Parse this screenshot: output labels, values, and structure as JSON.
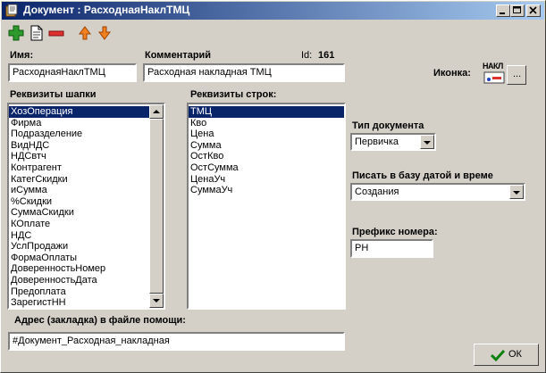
{
  "window": {
    "title": "Документ : РасходнаяНаклТМЦ"
  },
  "toolbar": {
    "icons": [
      "add-icon",
      "document-icon",
      "delete-icon",
      "move-up-icon",
      "move-down-icon"
    ]
  },
  "form": {
    "name_label": "Имя:",
    "name_value": "РасходнаяНаклТМЦ",
    "comment_label": "Комментарий",
    "id_label": "Id:",
    "id_value": "161",
    "comment_value": "Расходная накладная ТМЦ",
    "icon_label": "Иконка:",
    "icon_caption": "НАКЛ",
    "icon_button_label": "...",
    "header_props_label": "Реквизиты шапки",
    "header_props": [
      "ХозОперация",
      "Фирма",
      "Подразделение",
      "ВидНДС",
      "НДСвтч",
      "Контрагент",
      "КатегСкидки",
      "иСумма",
      "%Скидки",
      "СуммаСкидки",
      "КОплате",
      "НДС",
      "УслПродажи",
      "ФормаОплаты",
      "ДоверенностьНомер",
      "ДоверенностьДата",
      "Предоплата",
      "ЗарегистНН"
    ],
    "row_props_label": "Реквизиты строк:",
    "row_props": [
      "ТМЦ",
      "Кво",
      "Цена",
      "Сумма",
      "ОстКво",
      "ОстСумма",
      "ЦенаУч",
      "СуммаУч"
    ],
    "doc_type_label": "Тип документа",
    "doc_type_value": "Первичка",
    "write_label": "Писать в базу датой и време",
    "write_value": "Создания",
    "prefix_label": "Префикс номера:",
    "prefix_value": "РН",
    "help_label": "Адрес (закладка) в файле помощи:",
    "help_value": "#Документ_Расходная_накладная",
    "ok_label": "ОК"
  },
  "colors": {
    "title_start": "#0a246a",
    "title_end": "#a6caf0",
    "selection": "#0a246a",
    "face": "#d4d0c8"
  }
}
